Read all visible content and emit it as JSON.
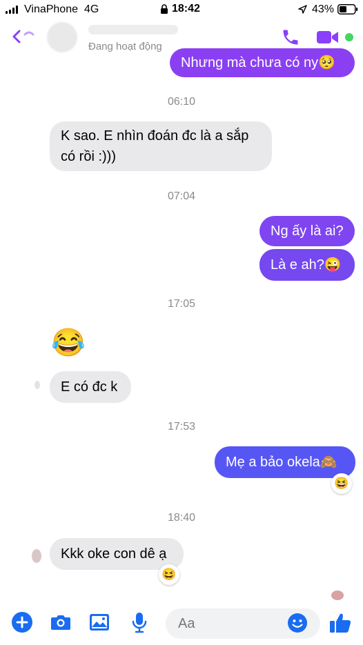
{
  "status_bar": {
    "carrier": "VinaPhone",
    "network": "4G",
    "time": "18:42",
    "battery": "43%"
  },
  "header": {
    "status": "Đang hoạt động",
    "online": true
  },
  "colors": {
    "accent": "#8a3ffc",
    "outgoing_purple": "#8b3ff2",
    "outgoing_blue": "#5656f5",
    "incoming_bg": "#e9e9eb",
    "online_green": "#44d65f"
  },
  "messages": {
    "m1": "Nhưng mà chưa có ny🥺",
    "t1": "06:10",
    "m2_line1": "K sao. E nhìn đoán đc là a sắp",
    "m2_line2": "có rồi :)))",
    "t2": "07:04",
    "m3": "Ng ấy là ai?",
    "m4": "Là e ah?😜",
    "t3": "17:05",
    "m5": "😂",
    "m6": "E có đc k",
    "t4": "17:53",
    "m7": "Mẹ a bảo okela🙈",
    "m7_reaction": "😆",
    "t5": "18:40",
    "m8": "Kkk oke con dê ạ",
    "m8_reaction": "😆"
  },
  "composer": {
    "placeholder": "Aa",
    "icons": [
      "plus-icon",
      "camera-icon",
      "gallery-icon",
      "microphone-icon",
      "emoji-icon",
      "like-icon"
    ]
  }
}
